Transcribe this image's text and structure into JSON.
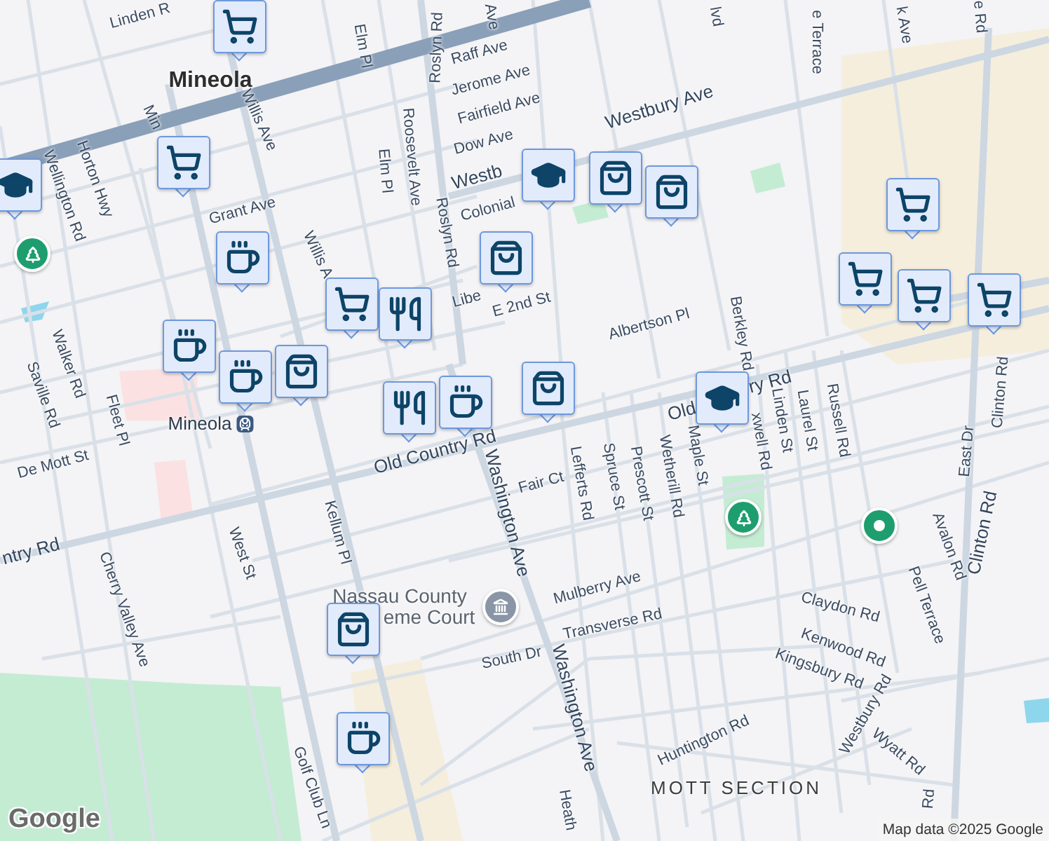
{
  "map": {
    "labels": [
      {
        "text": "Linden R",
        "kind": "street"
      },
      {
        "text": "Ave",
        "kind": "street"
      },
      {
        "text": "lvd",
        "kind": "street"
      },
      {
        "text": "e Terrace",
        "kind": "street"
      },
      {
        "text": "k Ave",
        "kind": "street"
      },
      {
        "text": "e Rd",
        "kind": "street"
      },
      {
        "text": "Mineola",
        "kind": "town"
      },
      {
        "text": "Elm Pl",
        "kind": "street"
      },
      {
        "text": "Roslyn Rd",
        "kind": "street"
      },
      {
        "text": "Raff Ave",
        "kind": "street"
      },
      {
        "text": "Jerome Ave",
        "kind": "street"
      },
      {
        "text": "Fairfield Ave",
        "kind": "street"
      },
      {
        "text": "Westbury Ave",
        "kind": "major"
      },
      {
        "text": "Min",
        "kind": "street"
      },
      {
        "text": "Willis Ave",
        "kind": "street"
      },
      {
        "text": "Dow Ave",
        "kind": "street"
      },
      {
        "text": "Westb",
        "kind": "major"
      },
      {
        "text": "Wellington Rd",
        "kind": "street"
      },
      {
        "text": "Horton Hwy",
        "kind": "street"
      },
      {
        "text": "Roosevelt Ave",
        "kind": "street"
      },
      {
        "text": "Elm Pl",
        "kind": "street"
      },
      {
        "text": "Grant Ave",
        "kind": "street"
      },
      {
        "text": "Roslyn Rd",
        "kind": "street"
      },
      {
        "text": "Colonial",
        "kind": "street"
      },
      {
        "text": "Willis A",
        "kind": "street"
      },
      {
        "text": "Libe",
        "kind": "street"
      },
      {
        "text": "E 2nd St",
        "kind": "street"
      },
      {
        "text": "Albertson Pl",
        "kind": "street"
      },
      {
        "text": "Berkley Rd",
        "kind": "street"
      },
      {
        "text": "ry Rd",
        "kind": "major"
      },
      {
        "text": "Old",
        "kind": "major"
      },
      {
        "text": "Saville Rd",
        "kind": "street"
      },
      {
        "text": "Walker Rd",
        "kind": "street"
      },
      {
        "text": "Fleet Pl",
        "kind": "street"
      },
      {
        "text": "Mineola",
        "kind": "station"
      },
      {
        "text": "Old Country Rd",
        "kind": "major"
      },
      {
        "text": "De Mott St",
        "kind": "street"
      },
      {
        "text": "Fair Ct",
        "kind": "street"
      },
      {
        "text": "Lefferts Rd",
        "kind": "street"
      },
      {
        "text": "Spruce St",
        "kind": "street"
      },
      {
        "text": "Prescott St",
        "kind": "street"
      },
      {
        "text": "Wetherill Rd",
        "kind": "street"
      },
      {
        "text": "Maple St",
        "kind": "street"
      },
      {
        "text": "xwell Rd",
        "kind": "street"
      },
      {
        "text": "Linden St",
        "kind": "street"
      },
      {
        "text": "Laurel St",
        "kind": "street"
      },
      {
        "text": "Russell Rd",
        "kind": "street"
      },
      {
        "text": "Clinton Rd",
        "kind": "street"
      },
      {
        "text": "East Dr",
        "kind": "street"
      },
      {
        "text": "ntry Rd",
        "kind": "major"
      },
      {
        "text": "West St",
        "kind": "street"
      },
      {
        "text": "Kellum Pl",
        "kind": "street"
      },
      {
        "text": "Cherry Valley Ave",
        "kind": "street"
      },
      {
        "text": "Washington Ave",
        "kind": "major"
      },
      {
        "text": "Clinton Rd",
        "kind": "major"
      },
      {
        "text": "Avalon Rd",
        "kind": "street"
      },
      {
        "text": "Pell Terrace",
        "kind": "street"
      },
      {
        "text": "Nassau County",
        "kind": "poi"
      },
      {
        "text": "eme Court",
        "kind": "poi"
      },
      {
        "text": "Mulberry Ave",
        "kind": "street"
      },
      {
        "text": "Claydon Rd",
        "kind": "street"
      },
      {
        "text": "Transverse Rd",
        "kind": "street"
      },
      {
        "text": "Kenwood Rd",
        "kind": "street"
      },
      {
        "text": "South Dr",
        "kind": "street"
      },
      {
        "text": "Kingsbury Rd",
        "kind": "street"
      },
      {
        "text": "Westbury Rd",
        "kind": "street"
      },
      {
        "text": "Washington Ave",
        "kind": "major"
      },
      {
        "text": "Wyatt Rd",
        "kind": "street"
      },
      {
        "text": "Huntington Rd",
        "kind": "street"
      },
      {
        "text": "MOTT SECTION",
        "kind": "area"
      },
      {
        "text": "Golf Club Ln",
        "kind": "street"
      },
      {
        "text": "Rd",
        "kind": "street"
      },
      {
        "text": "Heath",
        "kind": "street"
      }
    ],
    "pins": [
      {
        "kind": "cart"
      },
      {
        "kind": "cart"
      },
      {
        "kind": "cap"
      },
      {
        "kind": "cup"
      },
      {
        "kind": "cart"
      },
      {
        "kind": "cutlery"
      },
      {
        "kind": "cup"
      },
      {
        "kind": "bag"
      },
      {
        "kind": "cup"
      },
      {
        "kind": "cutlery"
      },
      {
        "kind": "cup"
      },
      {
        "kind": "cap"
      },
      {
        "kind": "bag"
      },
      {
        "kind": "bag"
      },
      {
        "kind": "bag"
      },
      {
        "kind": "bag"
      },
      {
        "kind": "cap"
      },
      {
        "kind": "cart"
      },
      {
        "kind": "cart"
      },
      {
        "kind": "cart"
      },
      {
        "kind": "cart"
      },
      {
        "kind": "bag"
      },
      {
        "kind": "cup"
      }
    ],
    "places": [
      {
        "kind": "park"
      },
      {
        "kind": "park"
      },
      {
        "kind": "dot"
      },
      {
        "kind": "court"
      }
    ]
  },
  "logo": "Google",
  "attribution": "Map data ©2025 Google"
}
